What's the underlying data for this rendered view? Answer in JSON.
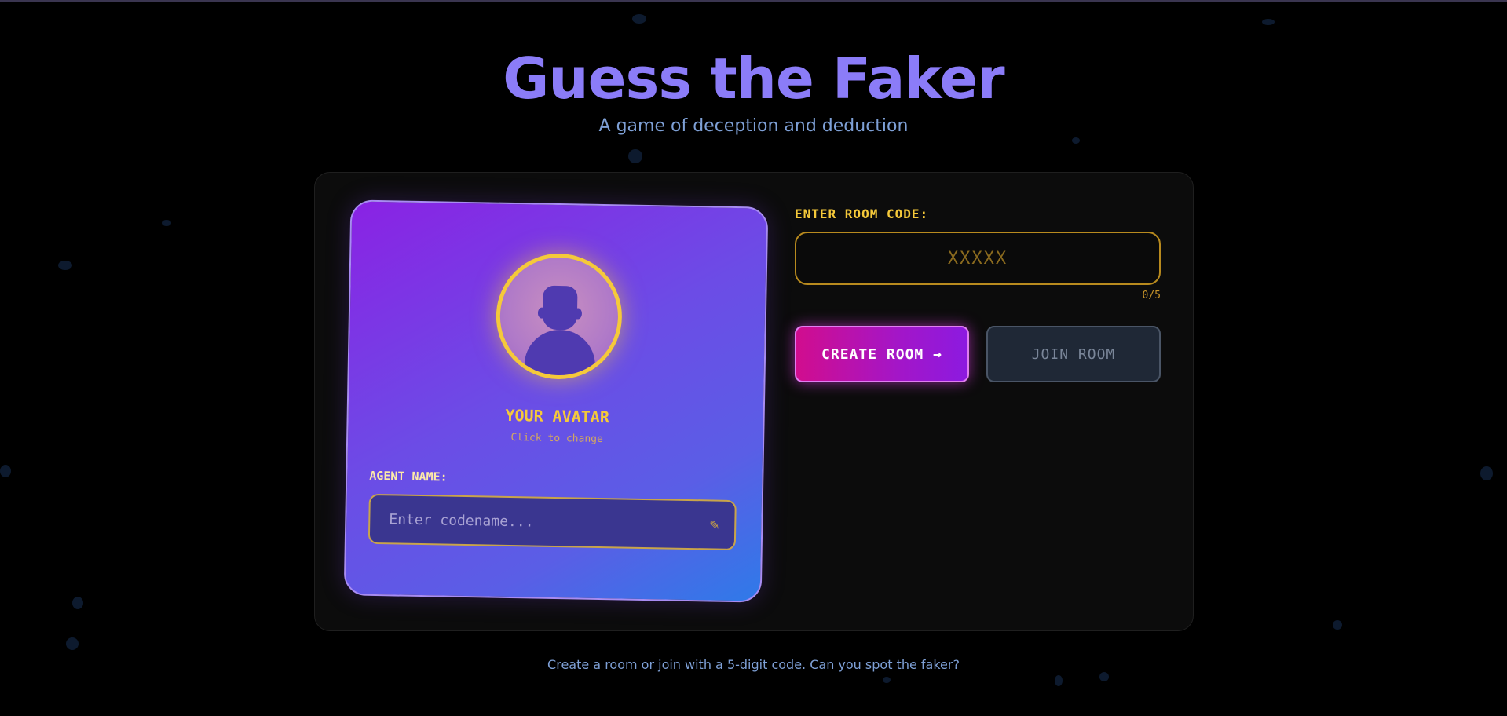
{
  "header": {
    "title": "Guess the Faker",
    "subtitle": "A game of deception and deduction"
  },
  "avatar_card": {
    "label": "YOUR AVATAR",
    "hint": "Click to change",
    "agent_name_label": "AGENT NAME:",
    "agent_name_value": "",
    "agent_name_placeholder": "Enter codename...",
    "edit_icon": "pencil-icon"
  },
  "room": {
    "label": "ENTER ROOM CODE:",
    "code_value": "",
    "code_placeholder": "XXXXX",
    "counter": "0/5",
    "create_label": "CREATE ROOM →",
    "join_label": "JOIN ROOM"
  },
  "footer": {
    "text": "Create a room or join with a 5-digit code. Can you spot the faker?"
  },
  "colors": {
    "background": "#000000",
    "title": "#8b7cf8",
    "gold": "#f5c93a",
    "create_gradient_start": "#d10d8e",
    "create_gradient_end": "#8c1ae0",
    "join_bg": "#1f2836"
  }
}
